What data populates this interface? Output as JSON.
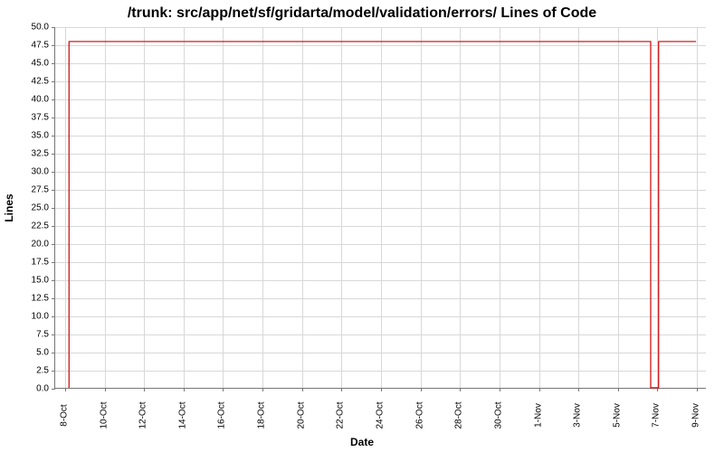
{
  "chart_data": {
    "type": "line",
    "title": "/trunk: src/app/net/sf/gridarta/model/validation/errors/ Lines of Code",
    "xlabel": "Date",
    "ylabel": "Lines",
    "ylim": [
      0.0,
      50.0
    ],
    "y_ticks": [
      0.0,
      2.5,
      5.0,
      7.5,
      10.0,
      12.5,
      15.0,
      17.5,
      20.0,
      22.5,
      25.0,
      27.5,
      30.0,
      32.5,
      35.0,
      37.5,
      40.0,
      42.5,
      45.0,
      47.5,
      50.0
    ],
    "x_ticks": [
      "8-Oct",
      "10-Oct",
      "12-Oct",
      "14-Oct",
      "16-Oct",
      "18-Oct",
      "20-Oct",
      "22-Oct",
      "24-Oct",
      "26-Oct",
      "28-Oct",
      "30-Oct",
      "1-Nov",
      "3-Nov",
      "5-Nov",
      "7-Nov",
      "9-Nov"
    ],
    "x_range_days": 33,
    "x_range_start_day_index": 0.5,
    "series": [
      {
        "name": "lines",
        "color": "#cc0000",
        "points": [
          {
            "day": 0.7,
            "value": 0
          },
          {
            "day": 0.7,
            "value": 48
          },
          {
            "day": 30.2,
            "value": 48
          },
          {
            "day": 30.2,
            "value": 0
          },
          {
            "day": 30.6,
            "value": 0
          },
          {
            "day": 30.6,
            "value": 48
          },
          {
            "day": 32.5,
            "value": 48
          }
        ]
      }
    ]
  }
}
